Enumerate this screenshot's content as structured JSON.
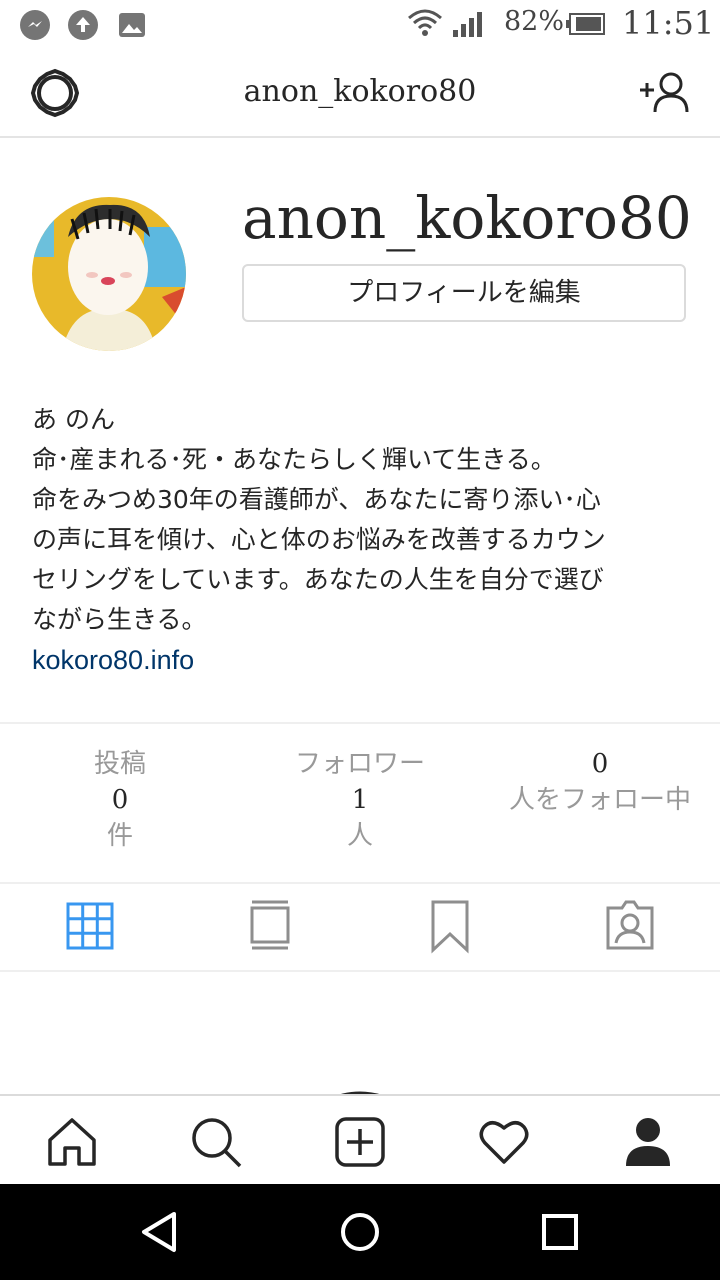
{
  "status_bar": {
    "battery": "82%",
    "time": "11:51",
    "icons": [
      "messenger-icon",
      "upload-icon",
      "gallery-icon",
      "wifi-icon",
      "signal-icon",
      "battery-icon"
    ]
  },
  "top_nav": {
    "title": "anon_kokoro80",
    "icons": [
      "settings-icon",
      "add-user-icon"
    ]
  },
  "profile": {
    "username": "anon_kokoro80",
    "edit_button": "プロフィールを編集",
    "bio_name": "あ のん",
    "bio_lines": [
      "命･産まれる･死・あなたらしく輝いて生きる。",
      "命をみつめ30年の看護師が、あなたに寄り添い･心",
      "の声に耳を傾け、心と体のお悩みを改善するカウン",
      "セリングをしています。あなたの人生を自分で選び",
      "ながら生きる。"
    ],
    "website": "kokoro80.info"
  },
  "stats": {
    "posts": {
      "label": "投稿",
      "value": "0",
      "unit": "件"
    },
    "followers": {
      "label": "フォロワー",
      "value": "1",
      "unit": "人"
    },
    "following": {
      "value": "0",
      "label": "人をフォロー中"
    }
  },
  "tabs": [
    "grid-icon",
    "feed-icon",
    "bookmark-icon",
    "tagged-icon"
  ],
  "bottom_nav": [
    "home-icon",
    "search-icon",
    "add-post-icon",
    "heart-icon",
    "profile-icon"
  ],
  "system_nav": [
    "back-icon",
    "home-circle-icon",
    "recents-icon"
  ],
  "colors": {
    "accent": "#3897f0",
    "link": "#003569",
    "text": "#262626",
    "muted": "#999999"
  }
}
